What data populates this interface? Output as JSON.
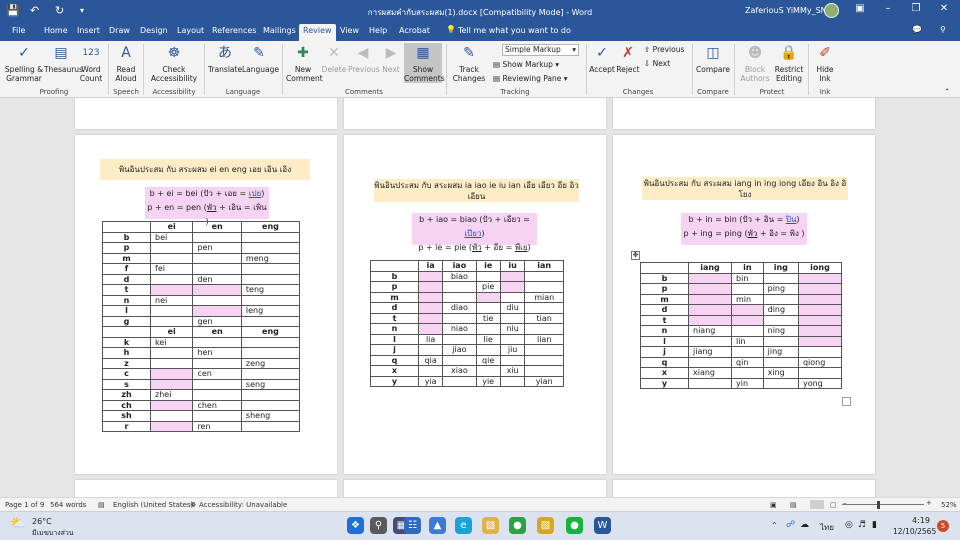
{
  "window": {
    "title": "การผสมคำกับสระผสม(1).docx [Compatibility Mode] - Word",
    "user": "ZaferiouS YiMMy_SN"
  },
  "tabs": [
    "File",
    "Home",
    "Insert",
    "Draw",
    "Design",
    "Layout",
    "References",
    "Mailings",
    "Review",
    "View",
    "Help",
    "Acrobat"
  ],
  "tell_me": "Tell me what you want to do",
  "ribbon": {
    "proofing": {
      "spelling": "Spelling &\nGrammar",
      "thesaurus": "Thesaurus",
      "word_count": "Word\nCount",
      "label": "Proofing"
    },
    "speech": {
      "read_aloud": "Read\nAloud",
      "label": "Speech"
    },
    "accessibility": {
      "check": "Check\nAccessibility",
      "label": "Accessibility"
    },
    "language": {
      "translate": "Translate",
      "language": "Language",
      "label": "Language"
    },
    "comments": {
      "new": "New\nComment",
      "delete": "Delete",
      "previous": "Previous",
      "next": "Next",
      "show": "Show\nComments",
      "label": "Comments"
    },
    "tracking": {
      "track": "Track\nChanges",
      "markup": "Simple Markup",
      "show_markup": "Show Markup",
      "reviewing_pane": "Reviewing Pane",
      "label": "Tracking"
    },
    "changes": {
      "accept": "Accept",
      "reject": "Reject",
      "previous": "Previous",
      "next": "Next",
      "label": "Changes"
    },
    "compare": {
      "compare": "Compare",
      "label": "Compare"
    },
    "protect": {
      "block": "Block\nAuthors",
      "restrict": "Restrict\nEditing",
      "label": "Protect"
    },
    "ink": {
      "hide": "Hide\nInk",
      "label": "Ink"
    }
  },
  "pages": [
    {
      "header": "พินอินประสม กับ สระผสม  ei   en  eng   เอย  เอิน  เอิง",
      "formula1": [
        "b + ei = bei (ปัว + เอย = ",
        "เปย",
        ")"
      ],
      "formula2": [
        "p + en = pen (",
        "พัว",
        " + เอิน = เพิน )"
      ],
      "columns": [
        "",
        "ei",
        "en",
        "eng"
      ],
      "rows": [
        [
          "b",
          "bei",
          "",
          ""
        ],
        [
          "p",
          "",
          "pen",
          ""
        ],
        [
          "m",
          "",
          "",
          "meng"
        ],
        [
          "f",
          "fei",
          "",
          ""
        ],
        [
          "d",
          "",
          "den",
          ""
        ],
        [
          "t",
          "",
          "",
          "teng"
        ],
        [
          "n",
          "nei",
          "",
          ""
        ],
        [
          "l",
          "",
          "",
          "leng"
        ],
        [
          "g",
          "",
          "gen",
          ""
        ],
        [
          "",
          "ei",
          "en",
          "eng"
        ],
        [
          "k",
          "kei",
          "",
          ""
        ],
        [
          "h",
          "",
          "hen",
          ""
        ],
        [
          "z",
          "",
          "",
          "zeng"
        ],
        [
          "c",
          "",
          "cen",
          ""
        ],
        [
          "s",
          "",
          "",
          "seng"
        ],
        [
          "zh",
          "zhei",
          "",
          ""
        ],
        [
          "ch",
          "",
          "chen",
          ""
        ],
        [
          "sh",
          "",
          "",
          "sheng"
        ],
        [
          "r",
          "",
          "ren",
          ""
        ]
      ]
    },
    {
      "header": "พินอินประสม กับ สระผสม ia  iao  ie  iu  ian  เอีย เอียว อีย อิว  เอียน",
      "formula1": [
        "b + iao = biao (ปัว + เอียว = ",
        "เปียว",
        ")"
      ],
      "formula2": [
        "p + ie = pie (",
        "พัว",
        " + อีย = ",
        "พีเย",
        ")"
      ],
      "columns": [
        "",
        "ia",
        "iao",
        "ie",
        "iu",
        "ian"
      ],
      "rows": [
        [
          "b",
          "",
          "biao",
          "",
          "",
          ""
        ],
        [
          "p",
          "",
          "",
          "pie",
          "",
          ""
        ],
        [
          "m",
          "",
          "",
          "",
          "",
          "mian"
        ],
        [
          "d",
          "",
          "diao",
          "",
          "diu",
          ""
        ],
        [
          "t",
          "",
          "",
          "tie",
          "",
          "tian"
        ],
        [
          "n",
          "",
          "niao",
          "",
          "niu",
          ""
        ],
        [
          "l",
          "lia",
          "",
          "lie",
          "",
          "lian"
        ],
        [
          "j",
          "",
          "jiao",
          "",
          "jiu",
          ""
        ],
        [
          "q",
          "qia",
          "",
          "qie",
          "",
          ""
        ],
        [
          "x",
          "",
          "xiao",
          "",
          "xiu",
          ""
        ],
        [
          "y",
          "yia",
          "",
          "yie",
          "",
          "yian"
        ]
      ]
    },
    {
      "header": "พินอินประสม กับ สระผสม iang  in  ing   iong  เอียง  อิน  อิง  อิโยง",
      "formula1": [
        "b + in = bin (ปัว + อิน = ",
        "ปิน",
        ")"
      ],
      "formula2": [
        "p + ing = ping (",
        "พัว",
        " + อิง = พิง )"
      ],
      "columns": [
        "",
        "iang",
        "in",
        "ing",
        "iong"
      ],
      "rows": [
        [
          "b",
          "",
          "bin",
          "",
          ""
        ],
        [
          "p",
          "",
          "",
          "ping",
          ""
        ],
        [
          "m",
          "",
          "min",
          "",
          ""
        ],
        [
          "d",
          "",
          "",
          "ding",
          ""
        ],
        [
          "t",
          "",
          "",
          "",
          ""
        ],
        [
          "n",
          "niang",
          "",
          "ning",
          ""
        ],
        [
          "l",
          "",
          "lin",
          "",
          ""
        ],
        [
          "j",
          "jiang",
          "",
          "jing",
          ""
        ],
        [
          "q",
          "",
          "qin",
          "",
          "qiong"
        ],
        [
          "x",
          "xiang",
          "",
          "xing",
          ""
        ],
        [
          "y",
          "",
          "yin",
          "",
          "yong"
        ]
      ]
    }
  ],
  "status": {
    "page": "Page 1 of 9",
    "words": "564 words",
    "language": "English (United States)",
    "accessibility": "Accessibility: Unavailable",
    "zoom": "52%"
  },
  "taskbar": {
    "temp": "26°C",
    "weather": "มีเมฆบางส่วน",
    "lang": "ไทย",
    "time": "4:19",
    "date": "12/10/2565",
    "badge": "5"
  }
}
